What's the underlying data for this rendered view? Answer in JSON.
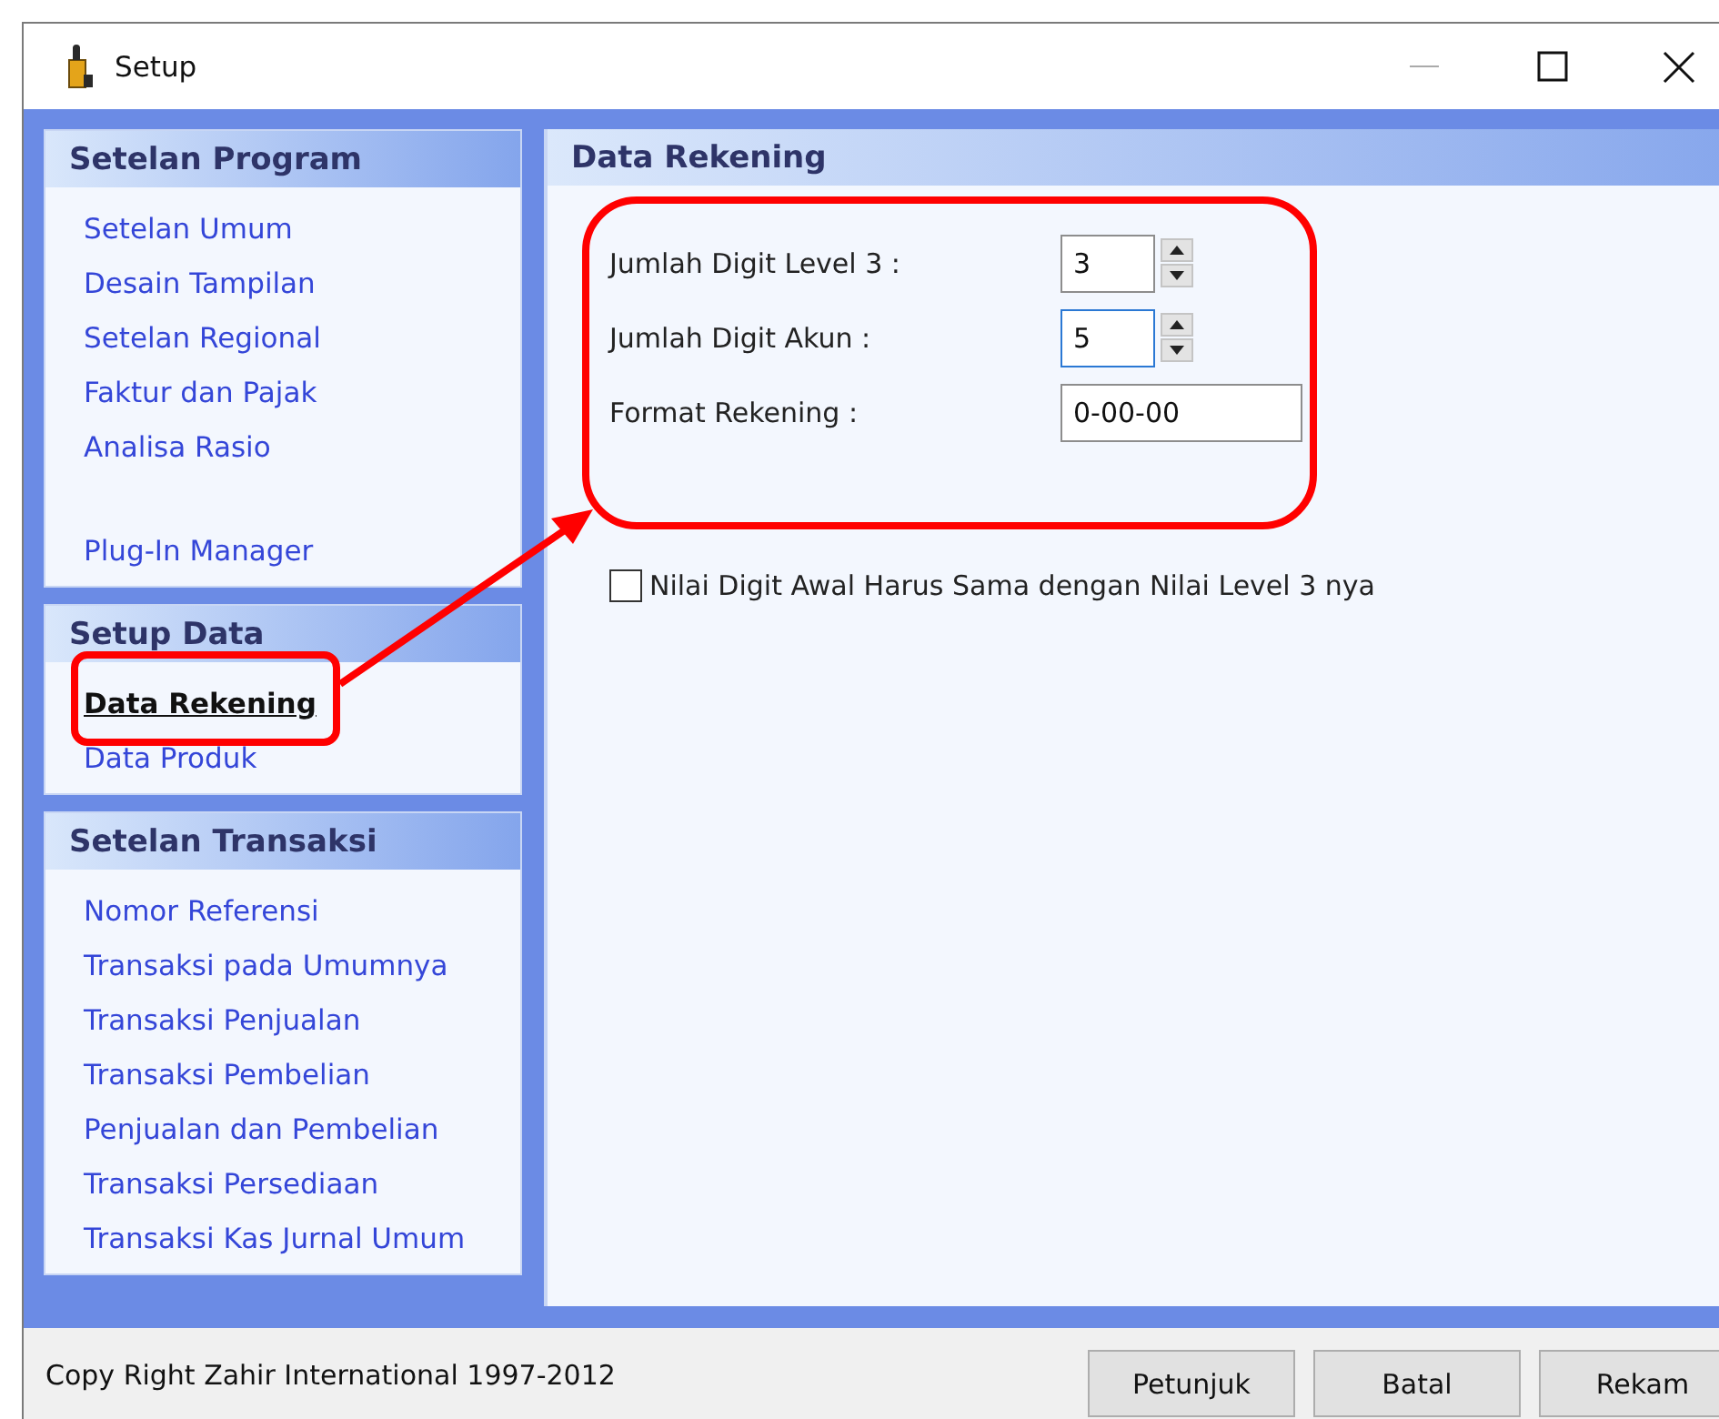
{
  "window": {
    "title": "Setup"
  },
  "sidebar": {
    "groups": [
      {
        "title": "Setelan Program",
        "items": [
          {
            "label": "Setelan Umum",
            "selected": false
          },
          {
            "label": "Desain Tampilan",
            "selected": false
          },
          {
            "label": "Setelan Regional",
            "selected": false
          },
          {
            "label": "Faktur dan Pajak",
            "selected": false
          },
          {
            "label": "Analisa Rasio",
            "selected": false
          },
          {
            "label": "Plug-In Manager",
            "selected": false
          }
        ]
      },
      {
        "title": "Setup Data",
        "items": [
          {
            "label": "Data Rekening",
            "selected": true
          },
          {
            "label": "Data Produk",
            "selected": false
          }
        ]
      },
      {
        "title": "Setelan Transaksi",
        "items": [
          {
            "label": "Nomor Referensi",
            "selected": false
          },
          {
            "label": "Transaksi pada Umumnya",
            "selected": false
          },
          {
            "label": "Transaksi Penjualan",
            "selected": false
          },
          {
            "label": "Transaksi Pembelian",
            "selected": false
          },
          {
            "label": "Penjualan dan Pembelian",
            "selected": false
          },
          {
            "label": "Transaksi Persediaan",
            "selected": false
          },
          {
            "label": "Transaksi Kas Jurnal Umum",
            "selected": false
          }
        ]
      }
    ]
  },
  "panel": {
    "title": "Data Rekening",
    "fields": [
      {
        "kind": "spinner",
        "label": "Jumlah Digit Level 3 :",
        "value": "3",
        "focused": false
      },
      {
        "kind": "spinner",
        "label": "Jumlah Digit Akun :",
        "value": "5",
        "focused": true
      },
      {
        "kind": "text",
        "label": "Format Rekening :",
        "value": "0-00-00",
        "focused": false
      }
    ],
    "checkbox": {
      "label": "Nilai Digit Awal Harus Sama dengan Nilai Level 3 nya",
      "checked": false
    }
  },
  "footer": {
    "copyright": "Copy Right Zahir International 1997-2012",
    "buttons": [
      "Petunjuk",
      "Batal",
      "Rekam"
    ]
  }
}
